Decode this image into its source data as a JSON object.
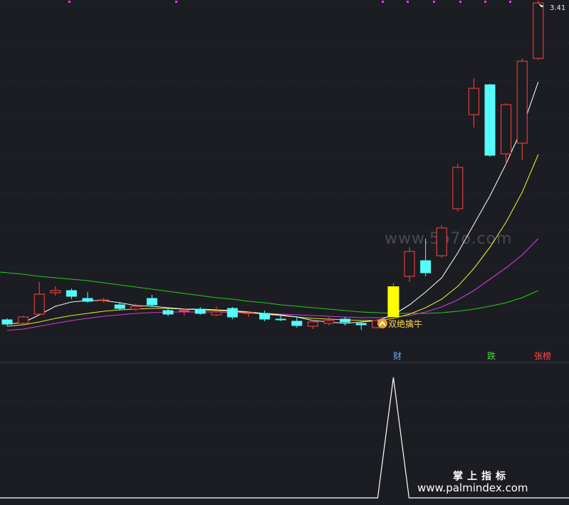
{
  "chart_data": {
    "type": "candlestick",
    "y_axis_label": "3.41",
    "signal_label": "双绝擒牛",
    "markers": [
      {
        "text": "财",
        "color": "#5ab0ff"
      },
      {
        "text": "跌",
        "color": "#3adf3a"
      },
      {
        "text": "张榜",
        "color": "#ff4a4a"
      }
    ],
    "candles": [
      {
        "o": 31,
        "c": 25,
        "h": 33,
        "l": 22
      },
      {
        "o": 26,
        "c": 35,
        "h": 37,
        "l": 24
      },
      {
        "o": 39,
        "c": 67,
        "h": 84,
        "l": 37
      },
      {
        "o": 69,
        "c": 72,
        "h": 78,
        "l": 65
      },
      {
        "o": 72,
        "c": 64,
        "h": 75,
        "l": 60
      },
      {
        "o": 61,
        "c": 57,
        "h": 70,
        "l": 55
      },
      {
        "o": 58,
        "c": 59,
        "h": 62,
        "l": 55
      },
      {
        "o": 52,
        "c": 47,
        "h": 56,
        "l": 44
      },
      {
        "o": 46,
        "c": 50,
        "h": 54,
        "l": 43
      },
      {
        "o": 61,
        "c": 52,
        "h": 66,
        "l": 49
      },
      {
        "o": 44,
        "c": 39,
        "h": 48,
        "l": 36
      },
      {
        "o": 44,
        "c": 44,
        "h": 47,
        "l": 37
      },
      {
        "o": 46,
        "c": 40,
        "h": 49,
        "l": 38
      },
      {
        "o": 38,
        "c": 42,
        "h": 50,
        "l": 36
      },
      {
        "o": 47,
        "c": 35,
        "h": 49,
        "l": 32
      },
      {
        "o": 40,
        "c": 41,
        "h": 43,
        "l": 35
      },
      {
        "o": 40,
        "c": 32,
        "h": 44,
        "l": 29
      },
      {
        "o": 32,
        "c": 31,
        "h": 37,
        "l": 29
      },
      {
        "o": 29,
        "c": 23,
        "h": 36,
        "l": 20
      },
      {
        "o": 22,
        "c": 28,
        "h": 31,
        "l": 18
      },
      {
        "o": 26,
        "c": 30,
        "h": 35,
        "l": 23
      },
      {
        "o": 32,
        "c": 28,
        "h": 35,
        "l": 23
      },
      {
        "o": 26,
        "c": 24,
        "h": 29,
        "l": 17
      },
      {
        "o": 20,
        "c": 30,
        "h": 32,
        "l": 19
      },
      {
        "o": 39,
        "c": 75,
        "h": 83,
        "l": 39
      },
      {
        "o": 92,
        "c": 127,
        "h": 133,
        "l": 84
      },
      {
        "o": 114,
        "c": 97,
        "h": 145,
        "l": 92
      },
      {
        "o": 121,
        "c": 160,
        "h": 164,
        "l": 118
      },
      {
        "o": 187,
        "c": 245,
        "h": 250,
        "l": 183
      },
      {
        "o": 319,
        "c": 356,
        "h": 370,
        "l": 301
      },
      {
        "o": 361,
        "c": 262,
        "h": 362,
        "l": 260
      },
      {
        "o": 264,
        "c": 333,
        "h": 335,
        "l": 248
      },
      {
        "o": 279,
        "c": 394,
        "h": 398,
        "l": 255
      },
      {
        "o": 398,
        "c": 476,
        "h": 479,
        "l": 396
      }
    ],
    "ma_fast": [
      25,
      27,
      38,
      50,
      56,
      58,
      58,
      55,
      51,
      50,
      48,
      46,
      46,
      45,
      44,
      42,
      40,
      38,
      35,
      30,
      28,
      26,
      28,
      30,
      38,
      52,
      70,
      90,
      125,
      165,
      205,
      250,
      300,
      365
    ],
    "ma_mid": [
      22,
      24,
      28,
      33,
      37,
      40,
      43,
      45,
      46,
      47,
      47,
      46,
      45,
      44,
      43,
      41,
      39,
      37,
      35,
      33,
      32,
      31,
      30,
      30,
      33,
      39,
      48,
      60,
      78,
      103,
      133,
      168,
      210,
      263
    ],
    "ma_slow": [
      16,
      18,
      22,
      26,
      30,
      33,
      36,
      38,
      40,
      41,
      42,
      42,
      42,
      42,
      41,
      41,
      40,
      39,
      38,
      37,
      36,
      35,
      34,
      34,
      35,
      37,
      42,
      49,
      59,
      72,
      88,
      104,
      122,
      145
    ],
    "ma_long": [
      98,
      95,
      92,
      90,
      88,
      86,
      83,
      80,
      77,
      74,
      71,
      68,
      65,
      62,
      60,
      57,
      55,
      52,
      50,
      48,
      46,
      44,
      42,
      41,
      40,
      40,
      40,
      41,
      43,
      46,
      50,
      55,
      62,
      72
    ],
    "indicator": {
      "baseline": 0,
      "spike_index": 24,
      "spike_value": 1
    }
  }
}
